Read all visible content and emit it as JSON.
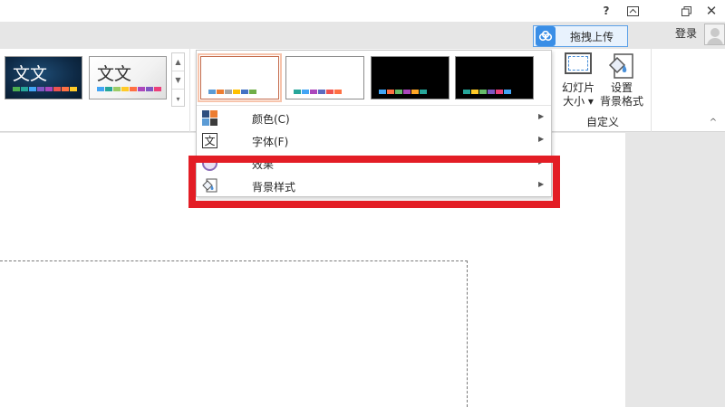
{
  "titlebar": {
    "help_glyph": "?",
    "ribbon_display_glyph": "⊼",
    "restore_glyph": "❐",
    "close_glyph": "✕"
  },
  "account": {
    "upload_label": "拖拽上传",
    "login_label": "登录"
  },
  "ribbon": {
    "themes": [
      {
        "sample_text": "文文",
        "swatches": [
          "#4caf50",
          "#26a69a",
          "#42a5f5",
          "#7e57c2",
          "#ab47bc",
          "#ef5350",
          "#ff7043",
          "#ffca28"
        ]
      },
      {
        "sample_text": "文文",
        "swatches": [
          "#42a5f5",
          "#26a69a",
          "#9ccc65",
          "#ffca28",
          "#ff7043",
          "#ab47bc",
          "#7e57c2",
          "#ec407a"
        ]
      }
    ],
    "gallery_scroll": {
      "up": "▲",
      "down": "▼",
      "more": "▾"
    },
    "customize": {
      "slide_size_label": "幻灯片\n大小 ▾",
      "format_background_label": "设置\n背景格式",
      "group_label": "自定义"
    },
    "collapse_glyph": "^"
  },
  "dropdown": {
    "variants": [
      {
        "swatches": [
          "#5b9bd5",
          "#ed7d31",
          "#a5a5a5",
          "#ffc000",
          "#4472c4",
          "#70ad47"
        ]
      },
      {
        "swatches": [
          "#26a69a",
          "#42a5f5",
          "#ab47bc",
          "#5c6bc0",
          "#ef5350",
          "#ff7043"
        ]
      },
      {
        "swatches": [
          "#42a5f5",
          "#ff7043",
          "#66bb6a",
          "#ab47bc",
          "#ffa726",
          "#26a69a"
        ]
      },
      {
        "swatches": [
          "#26a69a",
          "#ffca28",
          "#66bb6a",
          "#7e57c2",
          "#ec407a",
          "#42a5f5"
        ]
      }
    ],
    "menu_items": [
      {
        "label": "颜色(C)",
        "arrow": "▶"
      },
      {
        "label": "字体(F)",
        "arrow": "▶"
      },
      {
        "label": "效果",
        "arrow": "▶"
      },
      {
        "label": "背景样式",
        "arrow": "▶"
      }
    ]
  },
  "highlight": {
    "color": "#e31d25"
  }
}
